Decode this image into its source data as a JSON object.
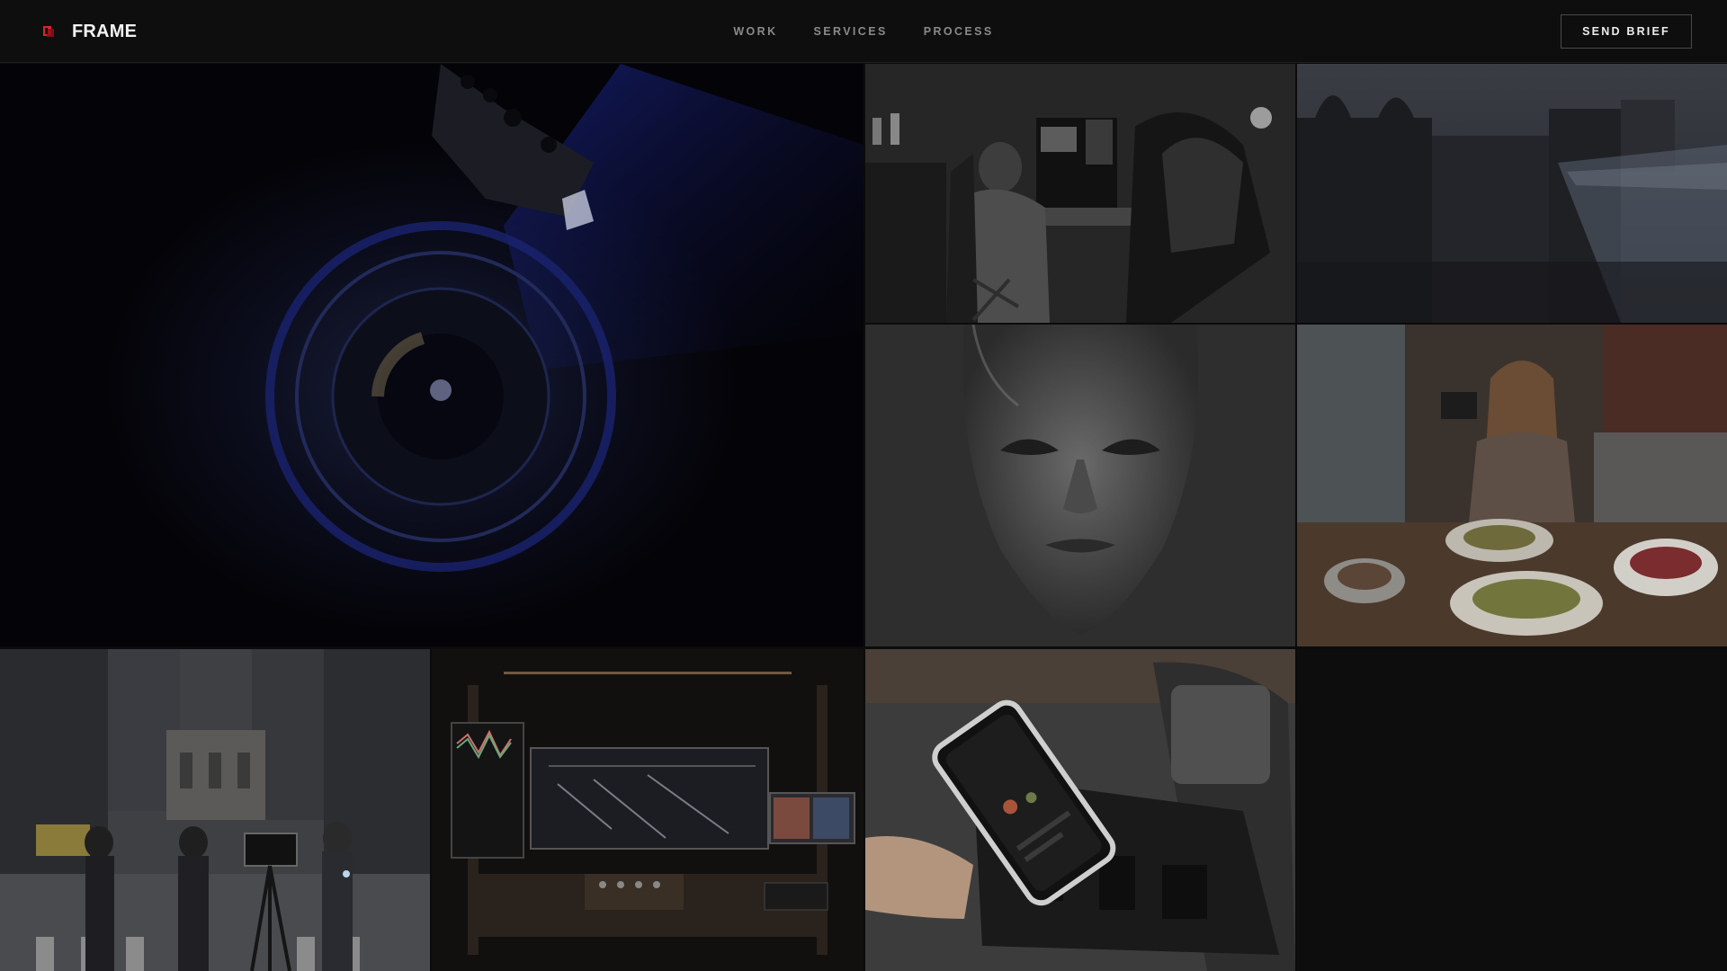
{
  "brand": {
    "name": "FRAME",
    "accent": "#d8262f",
    "icon": "frame-logo-icon"
  },
  "nav": {
    "items": [
      {
        "label": "WORK"
      },
      {
        "label": "SERVICES"
      },
      {
        "label": "PROCESS"
      }
    ]
  },
  "cta": {
    "label": "SEND BRIEF"
  },
  "gallery": {
    "tiles": [
      {
        "subject": "camera-lens"
      },
      {
        "subject": "editor-at-desk"
      },
      {
        "subject": "rooftop-city"
      },
      {
        "subject": "sculpted-face"
      },
      {
        "subject": "cafe-influencer"
      },
      {
        "subject": "city-street-camera"
      },
      {
        "subject": "editing-studio"
      },
      {
        "subject": "phone-gimbal"
      }
    ]
  }
}
